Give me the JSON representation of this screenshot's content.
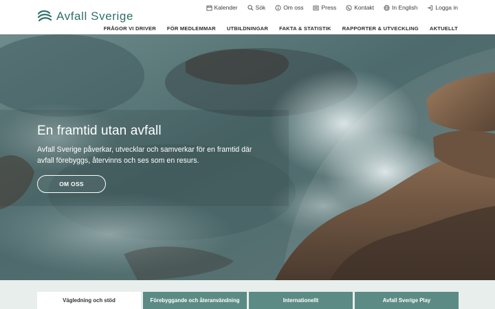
{
  "brand": {
    "name": "Avfall Sverige",
    "color": "#2f6e6a"
  },
  "utility_nav": [
    {
      "label": "Kalender",
      "icon": "calendar-icon"
    },
    {
      "label": "Sök",
      "icon": "search-icon"
    },
    {
      "label": "Om oss",
      "icon": "info-icon"
    },
    {
      "label": "Press",
      "icon": "newspaper-icon"
    },
    {
      "label": "Kontakt",
      "icon": "phone-icon"
    },
    {
      "label": "In English",
      "icon": "globe-icon"
    },
    {
      "label": "Logga in",
      "icon": "login-icon"
    }
  ],
  "main_nav": [
    {
      "label": "FRÅGOR VI DRIVER"
    },
    {
      "label": "FÖR MEDLEMMAR"
    },
    {
      "label": "UTBILDNINGAR"
    },
    {
      "label": "FAKTA & STATISTIK"
    },
    {
      "label": "RAPPORTER & UTVECKLING"
    },
    {
      "label": "AKTUELLT"
    }
  ],
  "hero": {
    "title": "En framtid utan avfall",
    "text": "Avfall Sverige påverkar, utvecklar och samverkar för en framtid där avfall förebyggs, återvinns och ses som en resurs.",
    "button": "OM OSS"
  },
  "tabs": [
    {
      "label": "Vägledning och stöd",
      "active": true
    },
    {
      "label": "Förebyggande och återanvändning",
      "active": false
    },
    {
      "label": "Internationellt",
      "active": false
    },
    {
      "label": "Avfall Sverige Play",
      "active": false
    }
  ]
}
